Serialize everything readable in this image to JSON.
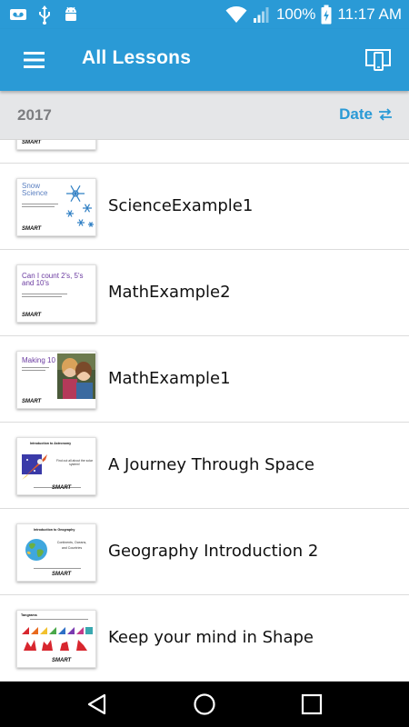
{
  "status_bar": {
    "battery": "100%",
    "time": "11:17 AM",
    "icons": [
      "voicemail-icon",
      "usb-icon",
      "android-icon",
      "wifi-icon",
      "signal-icon",
      "battery-charging-icon"
    ]
  },
  "app_bar": {
    "title": "All Lessons",
    "menu_icon": "hamburger-menu-icon",
    "device_icon": "devices-icon"
  },
  "section": {
    "year": "2017",
    "sort_label": "Date",
    "sort_icon": "swap-arrows-icon"
  },
  "thumbnails": {
    "smart": "SMART",
    "science1_heading": "Snow Science",
    "math2_heading": "Can I count 2's, 5's and 10's",
    "math1_heading": "Making 10",
    "space_heading": "Introduction to Astronomy",
    "space_sub": "Find out all about the solar system!",
    "geo_heading": "Introduction to Geography",
    "geo_sub": "Continents, Oceans, and Countries",
    "shape_heading": "Tangrams"
  },
  "lessons": [
    {
      "title": "ScienceExample1"
    },
    {
      "title": "MathExample2"
    },
    {
      "title": "MathExample1"
    },
    {
      "title": "A Journey Through Space"
    },
    {
      "title": "Geography Introduction 2"
    },
    {
      "title": "Keep your mind in Shape"
    }
  ],
  "colors": {
    "primary": "#2a9ad6",
    "header_bg": "#e5e6e8",
    "year_text": "#7c7d80"
  },
  "nav": {
    "back_icon": "back-triangle-icon",
    "home_icon": "home-circle-icon",
    "recents_icon": "recents-square-icon"
  }
}
